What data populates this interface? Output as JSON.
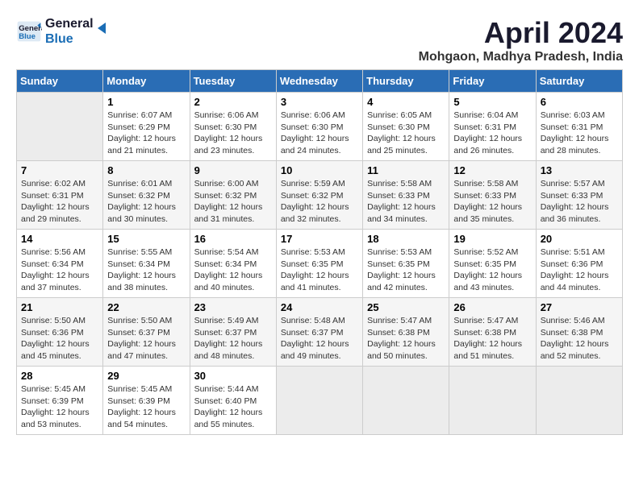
{
  "logo": {
    "line1": "General",
    "line2": "Blue"
  },
  "title": "April 2024",
  "location": "Mohgaon, Madhya Pradesh, India",
  "headers": [
    "Sunday",
    "Monday",
    "Tuesday",
    "Wednesday",
    "Thursday",
    "Friday",
    "Saturday"
  ],
  "weeks": [
    [
      {
        "day": "",
        "sunrise": "",
        "sunset": "",
        "daylight": ""
      },
      {
        "day": "1",
        "sunrise": "6:07 AM",
        "sunset": "6:29 PM",
        "daylight": "12 hours and 21 minutes."
      },
      {
        "day": "2",
        "sunrise": "6:06 AM",
        "sunset": "6:30 PM",
        "daylight": "12 hours and 23 minutes."
      },
      {
        "day": "3",
        "sunrise": "6:06 AM",
        "sunset": "6:30 PM",
        "daylight": "12 hours and 24 minutes."
      },
      {
        "day": "4",
        "sunrise": "6:05 AM",
        "sunset": "6:30 PM",
        "daylight": "12 hours and 25 minutes."
      },
      {
        "day": "5",
        "sunrise": "6:04 AM",
        "sunset": "6:31 PM",
        "daylight": "12 hours and 26 minutes."
      },
      {
        "day": "6",
        "sunrise": "6:03 AM",
        "sunset": "6:31 PM",
        "daylight": "12 hours and 28 minutes."
      }
    ],
    [
      {
        "day": "7",
        "sunrise": "6:02 AM",
        "sunset": "6:31 PM",
        "daylight": "12 hours and 29 minutes."
      },
      {
        "day": "8",
        "sunrise": "6:01 AM",
        "sunset": "6:32 PM",
        "daylight": "12 hours and 30 minutes."
      },
      {
        "day": "9",
        "sunrise": "6:00 AM",
        "sunset": "6:32 PM",
        "daylight": "12 hours and 31 minutes."
      },
      {
        "day": "10",
        "sunrise": "5:59 AM",
        "sunset": "6:32 PM",
        "daylight": "12 hours and 32 minutes."
      },
      {
        "day": "11",
        "sunrise": "5:58 AM",
        "sunset": "6:33 PM",
        "daylight": "12 hours and 34 minutes."
      },
      {
        "day": "12",
        "sunrise": "5:58 AM",
        "sunset": "6:33 PM",
        "daylight": "12 hours and 35 minutes."
      },
      {
        "day": "13",
        "sunrise": "5:57 AM",
        "sunset": "6:33 PM",
        "daylight": "12 hours and 36 minutes."
      }
    ],
    [
      {
        "day": "14",
        "sunrise": "5:56 AM",
        "sunset": "6:34 PM",
        "daylight": "12 hours and 37 minutes."
      },
      {
        "day": "15",
        "sunrise": "5:55 AM",
        "sunset": "6:34 PM",
        "daylight": "12 hours and 38 minutes."
      },
      {
        "day": "16",
        "sunrise": "5:54 AM",
        "sunset": "6:34 PM",
        "daylight": "12 hours and 40 minutes."
      },
      {
        "day": "17",
        "sunrise": "5:53 AM",
        "sunset": "6:35 PM",
        "daylight": "12 hours and 41 minutes."
      },
      {
        "day": "18",
        "sunrise": "5:53 AM",
        "sunset": "6:35 PM",
        "daylight": "12 hours and 42 minutes."
      },
      {
        "day": "19",
        "sunrise": "5:52 AM",
        "sunset": "6:35 PM",
        "daylight": "12 hours and 43 minutes."
      },
      {
        "day": "20",
        "sunrise": "5:51 AM",
        "sunset": "6:36 PM",
        "daylight": "12 hours and 44 minutes."
      }
    ],
    [
      {
        "day": "21",
        "sunrise": "5:50 AM",
        "sunset": "6:36 PM",
        "daylight": "12 hours and 45 minutes."
      },
      {
        "day": "22",
        "sunrise": "5:50 AM",
        "sunset": "6:37 PM",
        "daylight": "12 hours and 47 minutes."
      },
      {
        "day": "23",
        "sunrise": "5:49 AM",
        "sunset": "6:37 PM",
        "daylight": "12 hours and 48 minutes."
      },
      {
        "day": "24",
        "sunrise": "5:48 AM",
        "sunset": "6:37 PM",
        "daylight": "12 hours and 49 minutes."
      },
      {
        "day": "25",
        "sunrise": "5:47 AM",
        "sunset": "6:38 PM",
        "daylight": "12 hours and 50 minutes."
      },
      {
        "day": "26",
        "sunrise": "5:47 AM",
        "sunset": "6:38 PM",
        "daylight": "12 hours and 51 minutes."
      },
      {
        "day": "27",
        "sunrise": "5:46 AM",
        "sunset": "6:38 PM",
        "daylight": "12 hours and 52 minutes."
      }
    ],
    [
      {
        "day": "28",
        "sunrise": "5:45 AM",
        "sunset": "6:39 PM",
        "daylight": "12 hours and 53 minutes."
      },
      {
        "day": "29",
        "sunrise": "5:45 AM",
        "sunset": "6:39 PM",
        "daylight": "12 hours and 54 minutes."
      },
      {
        "day": "30",
        "sunrise": "5:44 AM",
        "sunset": "6:40 PM",
        "daylight": "12 hours and 55 minutes."
      },
      {
        "day": "",
        "sunrise": "",
        "sunset": "",
        "daylight": ""
      },
      {
        "day": "",
        "sunrise": "",
        "sunset": "",
        "daylight": ""
      },
      {
        "day": "",
        "sunrise": "",
        "sunset": "",
        "daylight": ""
      },
      {
        "day": "",
        "sunrise": "",
        "sunset": "",
        "daylight": ""
      }
    ]
  ]
}
